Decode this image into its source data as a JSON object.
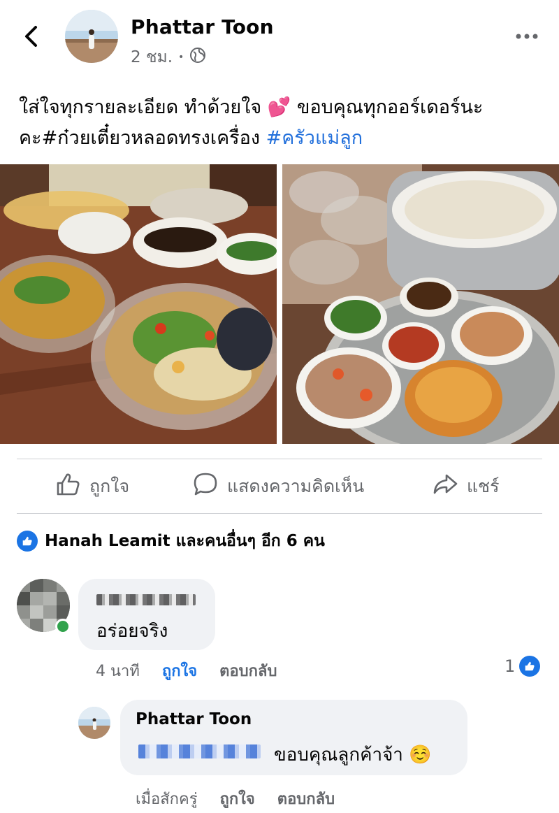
{
  "post": {
    "author": "Phattar Toon",
    "time": "2 ชม.",
    "meta_separator": "•",
    "text_main": "ใส่ใจทุกรายละเอียด ทำด้วยใจ 💕 ขอบคุณทุกออร์เดอร์นะ คะ#ก๋วยเตี๋ยวหลอดทรงเครื่อง ",
    "hashtag": "#ครัวแม่ลูก"
  },
  "actions": {
    "like_label": "ถูกใจ",
    "comment_label": "แสดงความคิดเห็น",
    "share_label": "แชร์"
  },
  "reactions": {
    "summary": "Hanah Leamit และคนอื่นๆ อีก 6 คน"
  },
  "comments": [
    {
      "text": "อร่อยจริง",
      "time": "4 นาที",
      "like_label": "ถูกใจ",
      "reply_label": "ตอบกลับ",
      "reaction_count": "1"
    }
  ],
  "reply": {
    "author": "Phattar Toon",
    "text": "ขอบคุณลูกค้าจ้า ☺️",
    "time": "เมื่อสักครู่",
    "like_label": "ถูกใจ",
    "reply_label": "ตอบกลับ"
  },
  "colors": {
    "accent": "#1b74e4",
    "hashtag": "#216fdb",
    "secondary_text": "#65676b",
    "bubble": "#f0f2f5",
    "online": "#31a24c"
  },
  "icons": [
    "back-arrow-icon",
    "globe-icon",
    "more-icon",
    "thumbs-up-icon",
    "comment-icon",
    "share-icon",
    "like-badge-icon"
  ]
}
